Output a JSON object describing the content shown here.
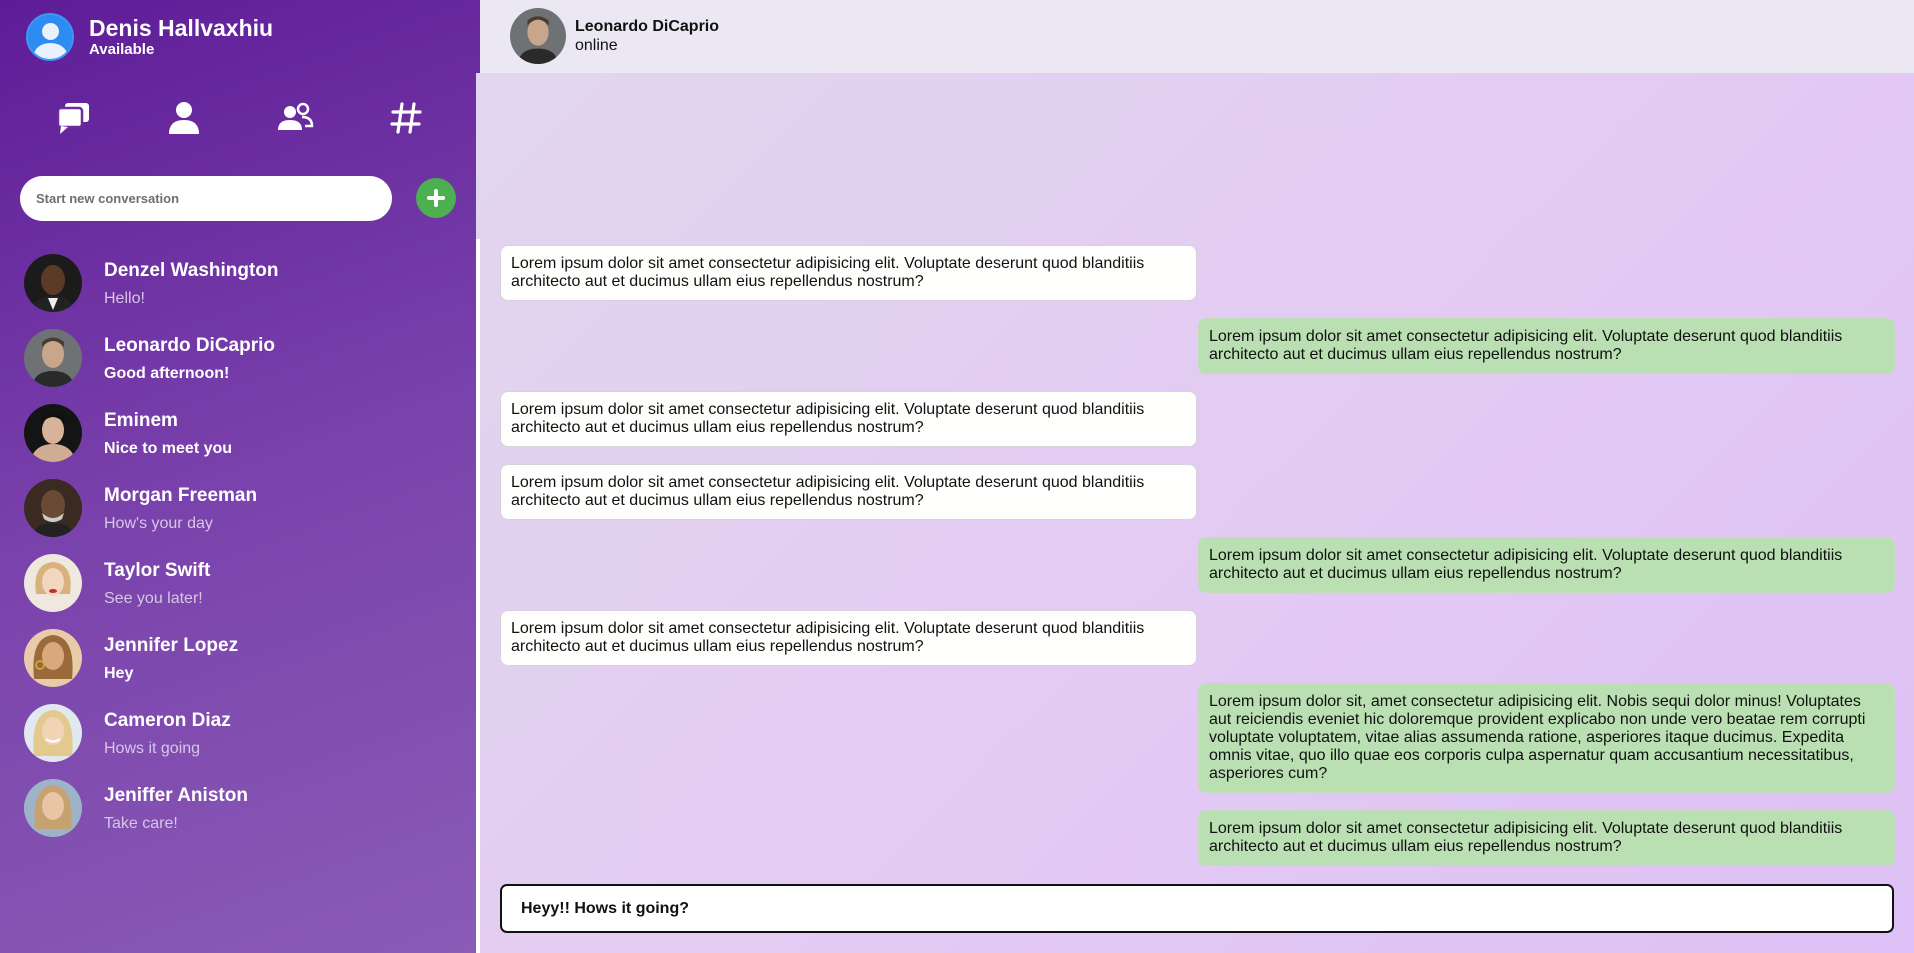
{
  "profile": {
    "name": "Denis Hallvaxhiu",
    "status": "Available"
  },
  "nav": {
    "icons": [
      "chat-bubbles-icon",
      "person-icon",
      "group-icon",
      "hashtag-icon"
    ]
  },
  "new_conversation": {
    "placeholder": "Start new conversation"
  },
  "contacts": [
    {
      "name": "Denzel Washington",
      "last": "Hello!",
      "unread": false
    },
    {
      "name": "Leonardo DiCaprio",
      "last": "Good afternoon!",
      "unread": true
    },
    {
      "name": "Eminem",
      "last": "Nice to meet you",
      "unread": true
    },
    {
      "name": "Morgan Freeman",
      "last": "How's your day",
      "unread": false
    },
    {
      "name": "Taylor Swift",
      "last": "See you later!",
      "unread": false
    },
    {
      "name": "Jennifer Lopez",
      "last": "Hey",
      "unread": true
    },
    {
      "name": "Cameron Diaz",
      "last": "Hows it going",
      "unread": false
    },
    {
      "name": "Jeniffer Aniston",
      "last": "Take care!",
      "unread": false
    }
  ],
  "chat": {
    "name": "Leonardo DiCaprio",
    "status": "online",
    "messages": [
      {
        "dir": "in",
        "text": "Lorem ipsum dolor sit amet consectetur adipisicing elit. Voluptate deserunt quod blanditiis architecto aut et ducimus ullam eius repellendus nostrum?"
      },
      {
        "dir": "out",
        "text": "Lorem ipsum dolor sit amet consectetur adipisicing elit. Voluptate deserunt quod blanditiis architecto aut et ducimus ullam eius repellendus nostrum?"
      },
      {
        "dir": "in",
        "text": "Lorem ipsum dolor sit amet consectetur adipisicing elit. Voluptate deserunt quod blanditiis architecto aut et ducimus ullam eius repellendus nostrum?"
      },
      {
        "dir": "in",
        "text": "Lorem ipsum dolor sit amet consectetur adipisicing elit. Voluptate deserunt quod blanditiis architecto aut et ducimus ullam eius repellendus nostrum?"
      },
      {
        "dir": "out",
        "text": "Lorem ipsum dolor sit amet consectetur adipisicing elit. Voluptate deserunt quod blanditiis architecto aut et ducimus ullam eius repellendus nostrum?"
      },
      {
        "dir": "in",
        "text": "Lorem ipsum dolor sit amet consectetur adipisicing elit. Voluptate deserunt quod blanditiis architecto aut et ducimus ullam eius repellendus nostrum?"
      },
      {
        "dir": "out",
        "text": "Lorem ipsum dolor sit, amet consectetur adipisicing elit. Nobis sequi dolor minus! Voluptates aut reiciendis eveniet hic doloremque provident explicabo non unde vero beatae rem corrupti voluptate voluptatem, vitae alias assumenda ratione, asperiores itaque ducimus. Expedita omnis vitae, quo illo quae eos corporis culpa aspernatur quam accusantium necessitatibus, asperiores cum?"
      },
      {
        "dir": "out",
        "text": "Lorem ipsum dolor sit amet consectetur adipisicing elit. Voluptate deserunt quod blanditiis architecto aut et ducimus ullam eius repellendus nostrum?"
      }
    ],
    "composer_value": "Heyy!! Hows it going?"
  },
  "colors": {
    "sidebar_start": "#5e1c97",
    "sidebar_end": "#8a5cb6",
    "incoming_bubble": "#fefefc",
    "outgoing_bubble": "#badfb2",
    "add_button": "#4caf50",
    "profile_avatar": "#2e8bf2"
  }
}
